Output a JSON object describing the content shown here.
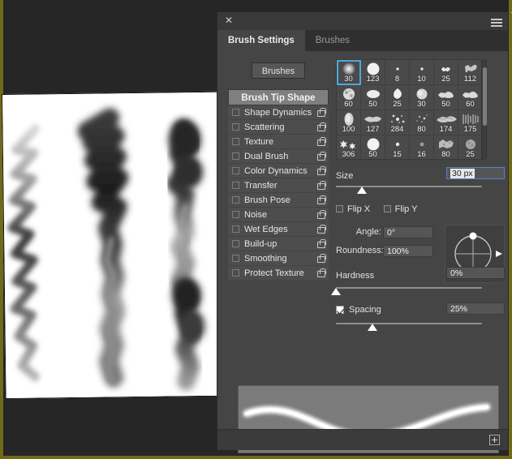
{
  "window": {
    "close_label": "✕",
    "collapse_icon": "«",
    "menu_icon": "panel-menu-icon"
  },
  "tabs": [
    {
      "label": "Brush Settings",
      "active": true
    },
    {
      "label": "Brushes",
      "active": false
    }
  ],
  "sidebar": {
    "brushes_button": "Brushes",
    "tip_shape_header": "Brush Tip Shape",
    "options": [
      {
        "label": "Shape Dynamics",
        "checked": false,
        "locked": true
      },
      {
        "label": "Scattering",
        "checked": false,
        "locked": true
      },
      {
        "label": "Texture",
        "checked": false,
        "locked": true
      },
      {
        "label": "Dual Brush",
        "checked": false,
        "locked": true
      },
      {
        "label": "Color Dynamics",
        "checked": false,
        "locked": true
      },
      {
        "label": "Transfer",
        "checked": false,
        "locked": true
      },
      {
        "label": "Brush Pose",
        "checked": false,
        "locked": true
      },
      {
        "label": "Noise",
        "checked": false,
        "locked": true
      },
      {
        "label": "Wet Edges",
        "checked": false,
        "locked": true
      },
      {
        "label": "Build-up",
        "checked": false,
        "locked": true
      },
      {
        "label": "Smoothing",
        "checked": false,
        "locked": true
      },
      {
        "label": "Protect Texture",
        "checked": false,
        "locked": true
      }
    ]
  },
  "brush_grid": {
    "selected_index": 0,
    "presets": [
      {
        "size": "30",
        "shape": "soft-round"
      },
      {
        "size": "123",
        "shape": "hard-round"
      },
      {
        "size": "8",
        "shape": "tiny-dot"
      },
      {
        "size": "10",
        "shape": "tiny-dot"
      },
      {
        "size": "25",
        "shape": "speckle"
      },
      {
        "size": "112",
        "shape": "scatter-texture"
      },
      {
        "size": "60",
        "shape": "rough-round"
      },
      {
        "size": "50",
        "shape": "flat-oval"
      },
      {
        "size": "25",
        "shape": "leaf"
      },
      {
        "size": "30",
        "shape": "soft-blob"
      },
      {
        "size": "50",
        "shape": "chalk-streak"
      },
      {
        "size": "60",
        "shape": "chalk-streak"
      },
      {
        "size": "100",
        "shape": "oval-texture"
      },
      {
        "size": "127",
        "shape": "smear"
      },
      {
        "size": "284",
        "shape": "spatter"
      },
      {
        "size": "80",
        "shape": "fine-spatter"
      },
      {
        "size": "174",
        "shape": "dry-brush"
      },
      {
        "size": "175",
        "shape": "bristle"
      },
      {
        "size": "306",
        "shape": "star-scatter"
      },
      {
        "size": "50",
        "shape": "hard-round"
      },
      {
        "size": "15",
        "shape": "small-dot"
      },
      {
        "size": "16",
        "shape": "faint-dot"
      },
      {
        "size": "80",
        "shape": "grunge"
      },
      {
        "size": "25",
        "shape": "soft-speckle"
      }
    ]
  },
  "controls": {
    "size": {
      "label": "Size",
      "value": "30 px",
      "slider_percent": 18
    },
    "flip_x": {
      "label": "Flip X",
      "checked": false
    },
    "flip_y": {
      "label": "Flip Y",
      "checked": false
    },
    "angle": {
      "label": "Angle:",
      "value": "0°"
    },
    "roundness": {
      "label": "Roundness:",
      "value": "100%"
    },
    "hardness": {
      "label": "Hardness",
      "value": "0%",
      "slider_percent": 0
    },
    "spacing": {
      "label": "Spacing",
      "value": "25%",
      "checked": true,
      "slider_percent": 25
    }
  },
  "footer": {
    "new_brush_icon": "new-brush-icon"
  },
  "colors": {
    "panel_bg": "#454545",
    "panel_header": "#393939",
    "tab_active": "#454545",
    "accent_selection": "#4ea8de",
    "field_active_border": "#5a7fd0",
    "text": "#e6e6e6",
    "canvas": "#ffffff",
    "frame": "#6e6a17"
  }
}
